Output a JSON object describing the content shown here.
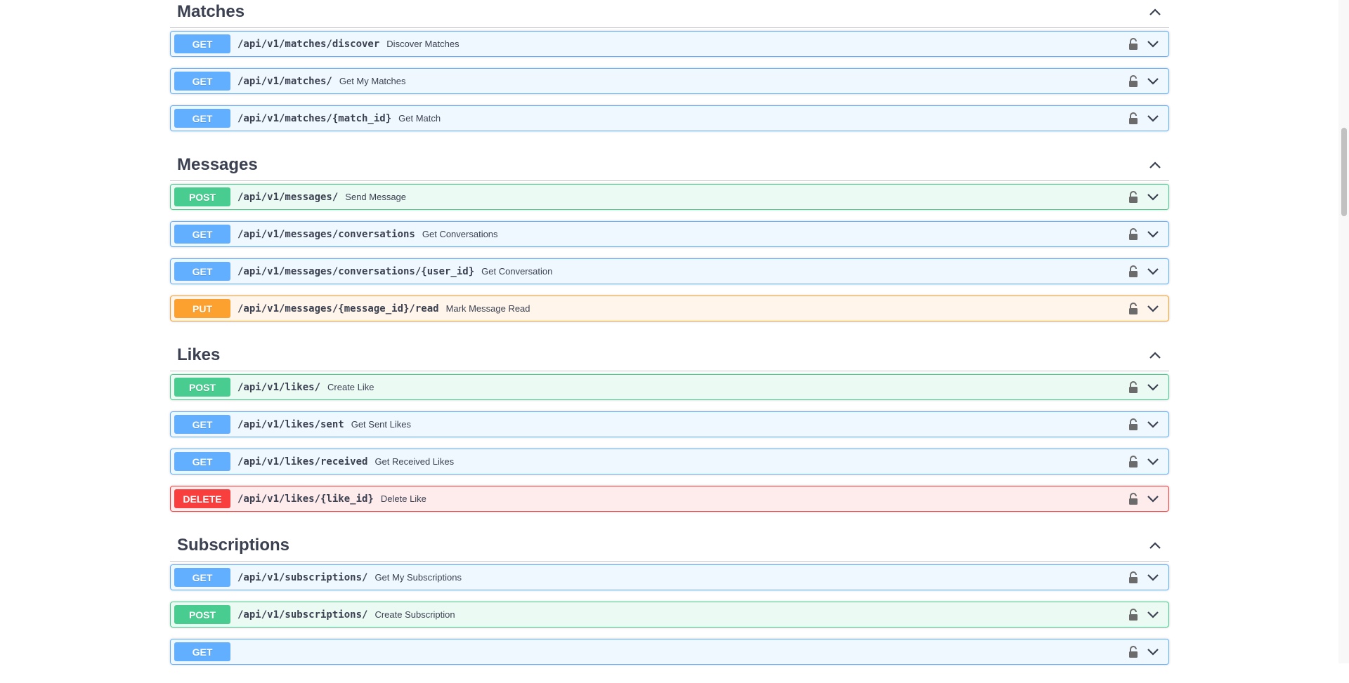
{
  "sections": [
    {
      "title": "Matches",
      "ops": [
        {
          "method": "GET",
          "cls": "get",
          "path": "/api/v1/matches/discover",
          "summary": "Discover Matches"
        },
        {
          "method": "GET",
          "cls": "get",
          "path": "/api/v1/matches/",
          "summary": "Get My Matches"
        },
        {
          "method": "GET",
          "cls": "get",
          "path": "/api/v1/matches/{match_id}",
          "summary": "Get Match"
        }
      ]
    },
    {
      "title": "Messages",
      "ops": [
        {
          "method": "POST",
          "cls": "post",
          "path": "/api/v1/messages/",
          "summary": "Send Message"
        },
        {
          "method": "GET",
          "cls": "get",
          "path": "/api/v1/messages/conversations",
          "summary": "Get Conversations"
        },
        {
          "method": "GET",
          "cls": "get",
          "path": "/api/v1/messages/conversations/{user_id}",
          "summary": "Get Conversation"
        },
        {
          "method": "PUT",
          "cls": "put",
          "path": "/api/v1/messages/{message_id}/read",
          "summary": "Mark Message Read"
        }
      ]
    },
    {
      "title": "Likes",
      "ops": [
        {
          "method": "POST",
          "cls": "post",
          "path": "/api/v1/likes/",
          "summary": "Create Like"
        },
        {
          "method": "GET",
          "cls": "get",
          "path": "/api/v1/likes/sent",
          "summary": "Get Sent Likes"
        },
        {
          "method": "GET",
          "cls": "get",
          "path": "/api/v1/likes/received",
          "summary": "Get Received Likes"
        },
        {
          "method": "DELETE",
          "cls": "delete",
          "path": "/api/v1/likes/{like_id}",
          "summary": "Delete Like"
        }
      ]
    },
    {
      "title": "Subscriptions",
      "ops": [
        {
          "method": "GET",
          "cls": "get",
          "path": "/api/v1/subscriptions/",
          "summary": "Get My Subscriptions"
        },
        {
          "method": "POST",
          "cls": "post",
          "path": "/api/v1/subscriptions/",
          "summary": "Create Subscription"
        },
        {
          "method": "GET",
          "cls": "get",
          "path": "",
          "summary": ""
        }
      ]
    }
  ],
  "icons": {
    "lock": "unlocked-lock-icon",
    "chevron": "chevron-down-icon",
    "section_toggle": "chevron-up-icon"
  },
  "colors": {
    "get": "#61affe",
    "post": "#49cc90",
    "put": "#fca130",
    "delete": "#f93e3e"
  }
}
